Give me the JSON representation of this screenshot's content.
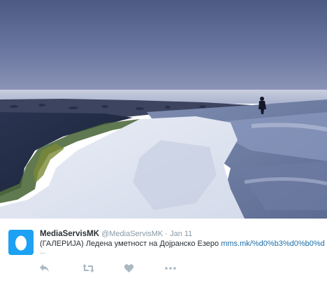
{
  "tweet": {
    "display_name": "MediaServisMK",
    "handle": "@MediaServisMK",
    "separator": "·",
    "date": "Jan 11",
    "text": "(ГАЛЕРИЈА) Ледена уметност на Дојранско Езеро ",
    "link_text": "mms.mk/%d0%b3%d0%b0%d",
    "ellipsis": "..."
  },
  "actions": [
    {
      "name": "reply",
      "icon": "reply-icon"
    },
    {
      "name": "retweet",
      "icon": "retweet-icon"
    },
    {
      "name": "like",
      "icon": "heart-icon"
    },
    {
      "name": "more",
      "icon": "more-icon"
    }
  ],
  "colors": {
    "avatar_bg": "#1da1f2",
    "name": "#292f33",
    "muted": "#8899a6",
    "link": "#1b6fa8",
    "action_icon": "#aab8c2"
  }
}
